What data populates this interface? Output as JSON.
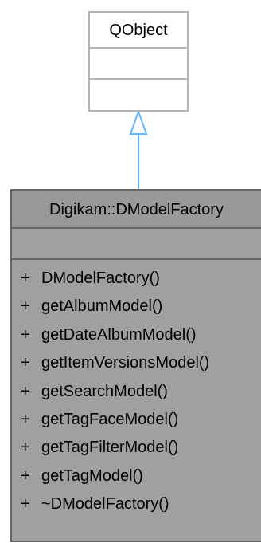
{
  "base_class": {
    "name": "QObject"
  },
  "derived_class": {
    "name": "Digikam::DModelFactory",
    "operations": [
      {
        "visibility": "+",
        "name": "DModelFactory()"
      },
      {
        "visibility": "+",
        "name": "getAlbumModel()"
      },
      {
        "visibility": "+",
        "name": "getDateAlbumModel()"
      },
      {
        "visibility": "+",
        "name": "getItemVersionsModel()"
      },
      {
        "visibility": "+",
        "name": "getSearchModel()"
      },
      {
        "visibility": "+",
        "name": "getTagFaceModel()"
      },
      {
        "visibility": "+",
        "name": "getTagFilterModel()"
      },
      {
        "visibility": "+",
        "name": "getTagModel()"
      },
      {
        "visibility": "+",
        "name": "~DModelFactory()"
      }
    ]
  },
  "relation": {
    "type": "inheritance",
    "color": "#63b8ff"
  }
}
